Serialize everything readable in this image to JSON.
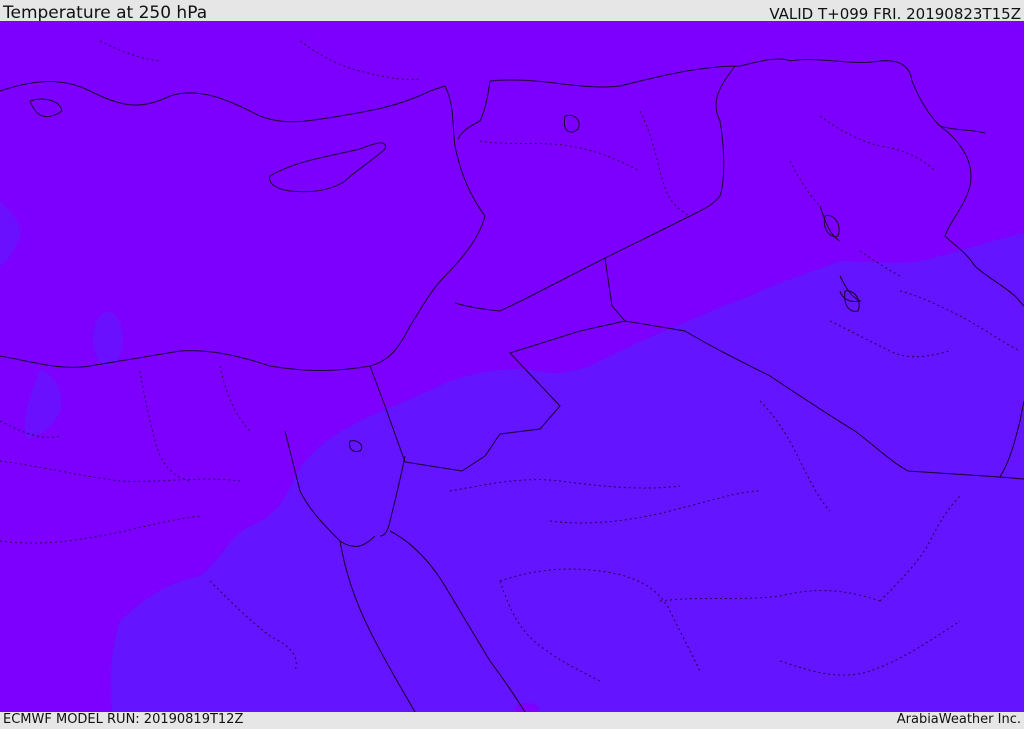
{
  "header": {
    "title": "Temperature at 250 hPa",
    "valid": "VALID T+099 FRI. 20190823T15Z"
  },
  "footer": {
    "model_run": "ECMWF MODEL RUN: 20190819T12Z",
    "credit": "ArabiaWeather Inc."
  },
  "map": {
    "field": "temperature-250hPa",
    "region": "Middle East / Eastern Mediterranean",
    "colors": {
      "warm_band": "#7d00ff",
      "cool_band": "#6414ff",
      "cool_patch": "#6a10ff",
      "border_line": "#1a0033"
    }
  }
}
